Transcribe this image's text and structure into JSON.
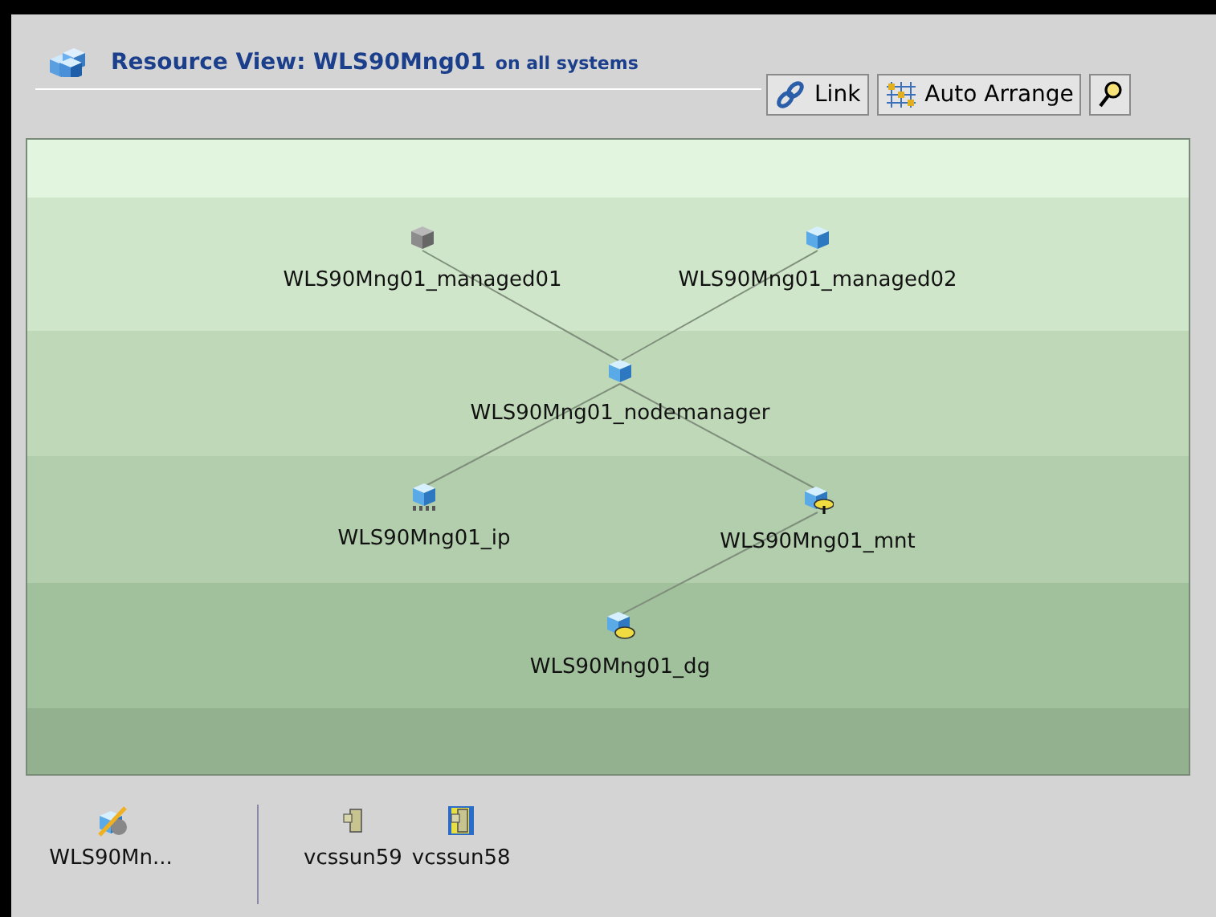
{
  "header": {
    "title": "Resource View: WLS90Mng01",
    "subtitle": "on all systems"
  },
  "toolbar": [
    {
      "kind": "link",
      "label": "Link"
    },
    {
      "kind": "arrange",
      "label": "Auto Arrange"
    },
    {
      "kind": "search"
    }
  ],
  "graph": {
    "nodes": [
      {
        "kind": "cube",
        "online": false,
        "label": "WLS90Mng01_managed01"
      },
      {
        "kind": "cube",
        "online": true,
        "label": "WLS90Mng01_managed02"
      },
      {
        "kind": "cube",
        "online": true,
        "label": "WLS90Mng01_nodemanager"
      },
      {
        "kind": "ip",
        "online": true,
        "label": "WLS90Mng01_ip"
      },
      {
        "kind": "mount",
        "online": true,
        "label": "WLS90Mng01_mnt"
      },
      {
        "kind": "disk",
        "online": true,
        "label": "WLS90Mng01_dg"
      }
    ]
  },
  "footer": {
    "group": {
      "label": "WLS90Mn..."
    },
    "systems": [
      {
        "label": "vcssun59",
        "selected": false
      },
      {
        "label": "vcssun58",
        "selected": true
      }
    ]
  }
}
